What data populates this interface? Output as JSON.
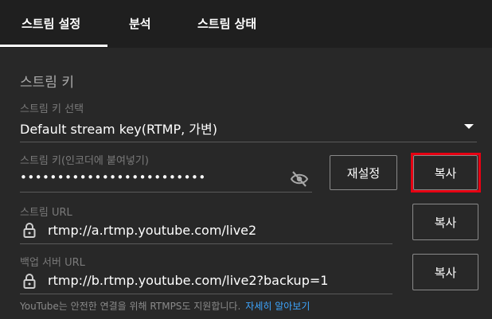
{
  "tabs": {
    "stream_settings": "스트림 설정",
    "analytics": "분석",
    "stream_status": "스트림 상태"
  },
  "section": {
    "title": "스트림 키"
  },
  "stream_key_select": {
    "label": "스트림 키 선택",
    "value": "Default stream key(RTMP, 가변)",
    "icon": "chevron-down-icon"
  },
  "stream_key": {
    "label": "스트림 키(인코더에 붙여넣기)",
    "value": "•••••••••••••••••••••••••",
    "visibility_icon": "eye-off-icon",
    "reset_label": "재설정",
    "copy_label": "복사"
  },
  "stream_url": {
    "label": "스트림 URL",
    "value": "rtmp://a.rtmp.youtube.com/live2",
    "icon": "lock-icon",
    "copy_label": "복사"
  },
  "backup_url": {
    "label": "백업 서버 URL",
    "value": "rtmp://b.rtmp.youtube.com/live2?backup=1",
    "icon": "lock-icon",
    "copy_label": "복사"
  },
  "footer": {
    "text": "YouTube는 안전한 연결을 위해 RTMPS도 지원합니다.",
    "link": "자세히 알아보기"
  },
  "colors": {
    "background": "#282828",
    "tabbar": "#1f1f1f",
    "highlight": "#e60012",
    "link": "#3ea6ff"
  }
}
